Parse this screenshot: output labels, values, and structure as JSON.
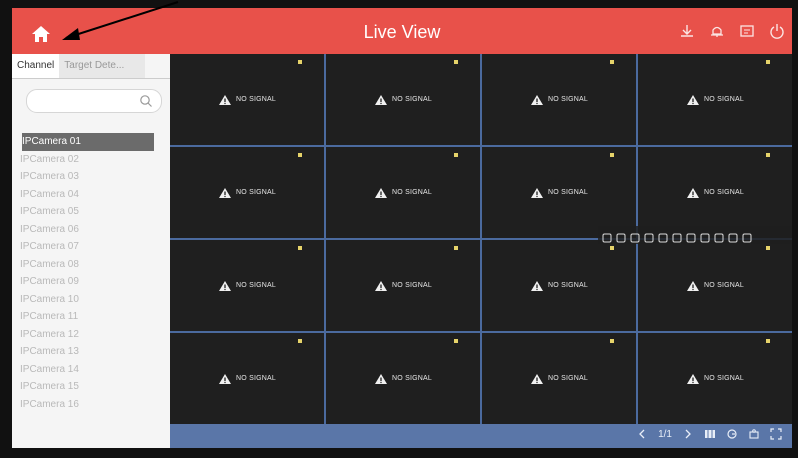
{
  "header": {
    "title": "Live View",
    "accent": "#e8514a"
  },
  "panel": {
    "tabs": [
      "Channel",
      "Target Dete..."
    ],
    "cameras": [
      "IPCamera 01",
      "IPCamera 02",
      "IPCamera 03",
      "IPCamera 04",
      "IPCamera 05",
      "IPCamera 06",
      "IPCamera 07",
      "IPCamera 08",
      "IPCamera 09",
      "IPCamera 10",
      "IPCamera 11",
      "IPCamera 12",
      "IPCamera 13",
      "IPCamera 14",
      "IPCamera 15",
      "IPCamera 16"
    ],
    "selected_index": 0
  },
  "grid": {
    "tiles": [
      "NO SIGNAL",
      "NO SIGNAL",
      "NO SIGNAL",
      "NO SIGNAL",
      "NO SIGNAL",
      "NO SIGNAL",
      "NO SIGNAL",
      "NO SIGNAL",
      "NO SIGNAL",
      "NO SIGNAL",
      "NO SIGNAL",
      "NO SIGNAL",
      "NO SIGNAL",
      "NO SIGNAL",
      "NO SIGNAL",
      "NO SIGNAL"
    ]
  },
  "pager": {
    "page": "1/1"
  },
  "icons": {
    "header": [
      "download-icon",
      "alarm-icon",
      "record-icon",
      "power-icon"
    ],
    "toolbar": [
      "capture-icon",
      "playback-icon",
      "person-icon",
      "zoom-icon",
      "audio-icon",
      "adjust-icon",
      "info-icon",
      "lock-icon",
      "ptz-icon",
      "screen-icon",
      "close-icon"
    ],
    "bottom": [
      "prev-icon",
      "next-icon",
      "layout-icon",
      "refresh-icon",
      "camera-icon",
      "fullscreen-icon"
    ]
  }
}
